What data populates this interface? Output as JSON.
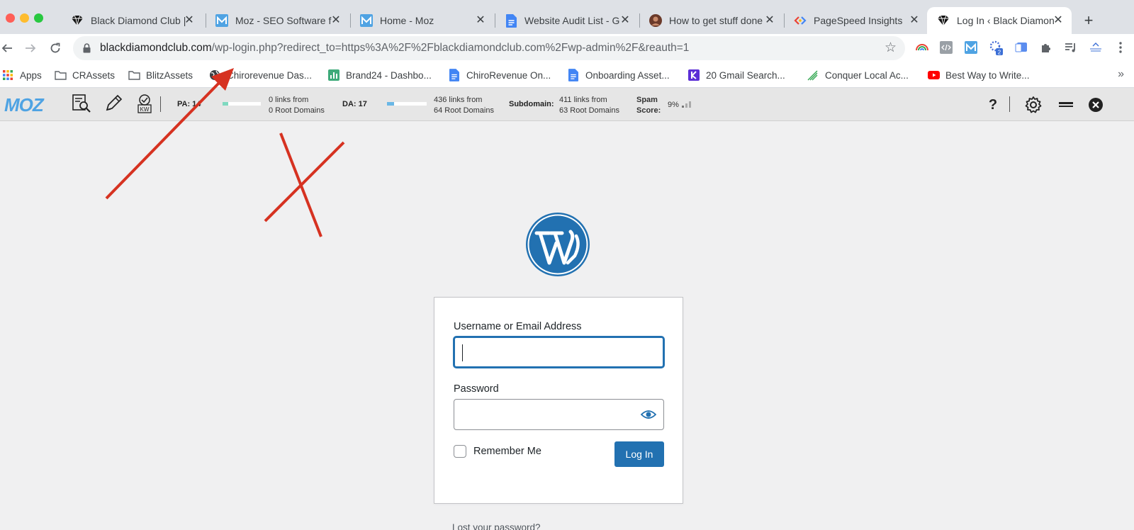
{
  "browser": {
    "tabs": [
      {
        "title": "Black Diamond Club |",
        "icon": "diamond-icon"
      },
      {
        "title": "Moz - SEO Software f",
        "icon": "moz-icon"
      },
      {
        "title": "Home - Moz",
        "icon": "moz-icon"
      },
      {
        "title": "Website Audit List - G",
        "icon": "google-docs-icon"
      },
      {
        "title": "How to get stuff done",
        "icon": "avatar-icon"
      },
      {
        "title": "PageSpeed Insights",
        "icon": "pagespeed-icon"
      },
      {
        "title": "Log In ‹ Black Diamon",
        "icon": "diamond-icon",
        "active": true
      }
    ],
    "url_host": "blackdiamondclub.com",
    "url_path": "/wp-login.php?redirect_to=https%3A%2F%2Fblackdiamondclub.com%2Fwp-admin%2F&reauth=1",
    "extension_badge": "2",
    "bookmarks": [
      {
        "label": "Apps",
        "icon": "apps-grid-icon"
      },
      {
        "label": "CRAssets",
        "icon": "folder-icon"
      },
      {
        "label": "BlitzAssets",
        "icon": "folder-icon"
      },
      {
        "label": "Chirorevenue Das...",
        "icon": "globe-icon"
      },
      {
        "label": "Brand24 - Dashbo...",
        "icon": "bar-chart-icon"
      },
      {
        "label": "ChiroRevenue On...",
        "icon": "google-docs-icon"
      },
      {
        "label": "Onboarding Asset...",
        "icon": "google-docs-icon"
      },
      {
        "label": "20 Gmail Search...",
        "icon": "k-icon"
      },
      {
        "label": "Conquer Local Ac...",
        "icon": "growth-chart-icon"
      },
      {
        "label": "Best Way to Write...",
        "icon": "youtube-icon"
      }
    ],
    "bookmarks_more": "»"
  },
  "mozbar": {
    "logo": "MOZ",
    "pa_label": "PA: 14",
    "pa_links_line1": "0 links from",
    "pa_links_line2": "0 Root Domains",
    "da_label": "DA: 17",
    "da_links_line1": "436 links from",
    "da_links_line2": "64 Root Domains",
    "subdomain_label": "Subdomain:",
    "sub_links_line1": "411 links from",
    "sub_links_line2": "63 Root Domains",
    "spam_label_line1": "Spam",
    "spam_label_line2": "Score:",
    "spam_value": "9%",
    "help": "?"
  },
  "login": {
    "username_label": "Username or Email Address",
    "username_value": "",
    "password_label": "Password",
    "password_value": "",
    "remember_label": "Remember Me",
    "remember_checked": false,
    "submit_label": "Log In",
    "lost_password": "Lost your password?"
  },
  "colors": {
    "wp_blue": "#2271b1",
    "annotation_red": "#d63221",
    "moz_blue": "#4fa3e3"
  }
}
